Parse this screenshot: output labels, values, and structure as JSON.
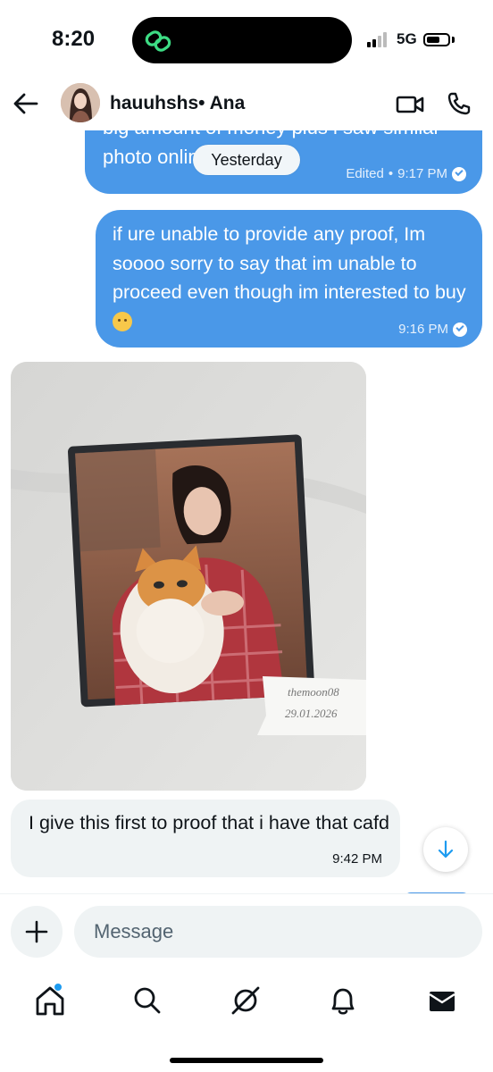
{
  "status_bar": {
    "time": "8:20",
    "network": "5G"
  },
  "header": {
    "contact_name": "hauuhshs• Ana"
  },
  "chat": {
    "date_separator": "Yesterday",
    "messages": [
      {
        "direction": "outgoing",
        "text": "big amount of money plus i saw similar photo online",
        "edited_label": "Edited",
        "time": "9:17 PM"
      },
      {
        "direction": "outgoing",
        "text": "if ure unable to provide any proof, Im soooo sorry to say that im unable to proceed even though im interested to buy",
        "time": "9:16 PM"
      },
      {
        "direction": "incoming",
        "type": "photo",
        "note_line1": "themoon08",
        "note_line2": "29.01.2026"
      },
      {
        "direction": "incoming",
        "text": "I give this first to proof that i have that cafd",
        "time": "9:42 PM"
      }
    ]
  },
  "composer": {
    "placeholder": "Message"
  },
  "tabs": [
    "home-icon",
    "search-icon",
    "grok-icon",
    "notifications-icon",
    "messages-icon"
  ],
  "colors": {
    "outgoing_bubble": "#4a98e8",
    "incoming_bubble": "#eff3f4",
    "accent": "#1d9bf0"
  }
}
